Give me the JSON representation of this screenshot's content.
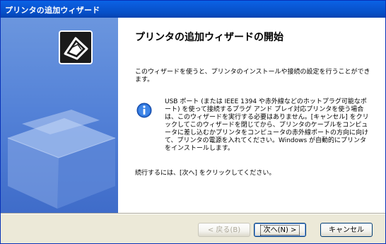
{
  "window": {
    "title": "プリンタの追加ウィザード"
  },
  "main": {
    "heading": "プリンタの追加ウィザードの開始",
    "intro": "このウィザードを使うと、プリンタのインストールや接続の設定を行うことができます。",
    "info_text": "USB ポート (または IEEE 1394 や赤外線などのホットプラグ可能なポート) を使って接続するプラグ アンド プレイ対応プリンタを使う場合は、このウィザードを実行する必要はありません。[キャンセル] をクリックしてこのウィザードを閉じてから、プリンタのケーブルをコンピュータに差し込むかプリンタをコンピュータの赤外線ポートの方向に向けて、プリンタの電源を入れてください。Windows が自動的にプリンタをインストールします。",
    "instruction": "続行するには、[次へ] をクリックしてください。"
  },
  "buttons": {
    "back_label": "< 戻る(B)",
    "next_label": "次へ(N) >",
    "cancel_label": "キャンセル"
  },
  "icons": {
    "wizard": "printer-wizard-icon",
    "info": "info-icon"
  },
  "colors": {
    "titlebar": "#0a59d8",
    "sidebar": "#5583d8",
    "button_border": "#003c74"
  }
}
